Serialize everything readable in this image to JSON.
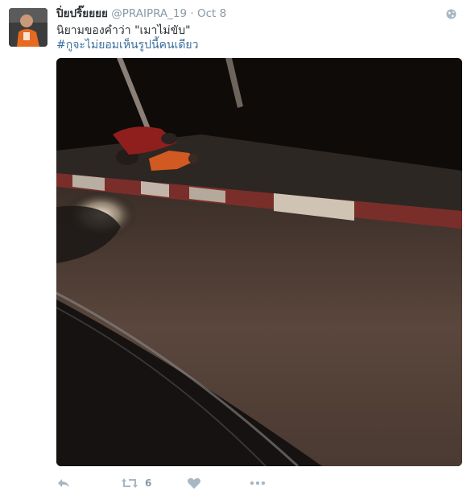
{
  "tweet": {
    "display_name": "ปิ่ยปริ๊ยยยย",
    "handle": "@PRAIPRA_19",
    "separator": "·",
    "date": "Oct 8",
    "text_line1": "นิยามของคำว่า \"เมาไม่ขับ\"",
    "hashtag": "#กูจะไม่ยอมเห็นรูปนี้คนเดียว"
  },
  "actions": {
    "retweet_count": "6"
  },
  "icons": {
    "globe": "globe-icon",
    "reply": "reply-icon",
    "retweet": "retweet-icon",
    "like": "heart-icon",
    "more": "more-icon"
  },
  "colors": {
    "link": "#3b6e9c",
    "muted": "#8899a6",
    "text": "#292f33"
  }
}
